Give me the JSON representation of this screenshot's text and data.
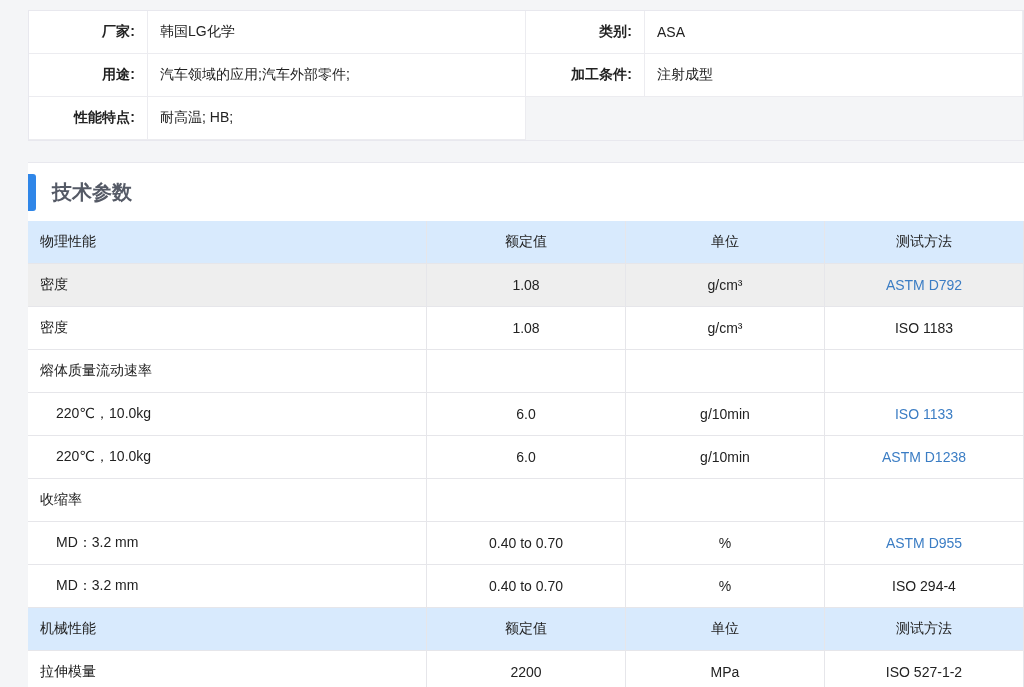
{
  "info": {
    "rows": [
      {
        "cells": [
          {
            "label": "厂家:",
            "value": "韩国LG化学"
          },
          {
            "label": "类别:",
            "value": "ASA"
          }
        ]
      },
      {
        "cells": [
          {
            "label": "用途:",
            "value": "汽车领域的应用;汽车外部零件;"
          },
          {
            "label": "加工条件:",
            "value": "注射成型"
          }
        ]
      },
      {
        "cells": [
          {
            "label": "性能特点:",
            "value": "耐高温; HB;"
          }
        ]
      }
    ]
  },
  "tech": {
    "title": "技术参数",
    "rows": [
      {
        "kind": "header",
        "name": "物理性能",
        "value": "额定值",
        "unit": "单位",
        "method": "测试方法"
      },
      {
        "kind": "data",
        "highlighted": true,
        "name": "密度",
        "value": "1.08",
        "unit": "g/cm³",
        "method": "ASTM D792",
        "link": true
      },
      {
        "kind": "data",
        "highlighted": false,
        "name": "密度",
        "value": "1.08",
        "unit": "g/cm³",
        "method": "ISO 1183",
        "link": false
      },
      {
        "kind": "group",
        "name": "熔体质量流动速率"
      },
      {
        "kind": "sub",
        "highlighted": false,
        "name": "220℃，10.0kg",
        "value": "6.0",
        "unit": "g/10min",
        "method": "ISO 1133",
        "link": true
      },
      {
        "kind": "sub",
        "highlighted": false,
        "name": "220℃，10.0kg",
        "value": "6.0",
        "unit": "g/10min",
        "method": "ASTM D1238",
        "link": true
      },
      {
        "kind": "group",
        "name": "收缩率"
      },
      {
        "kind": "sub",
        "highlighted": false,
        "name": "MD：3.2 mm",
        "value": "0.40 to 0.70",
        "unit": "%",
        "method": "ASTM D955",
        "link": true
      },
      {
        "kind": "sub",
        "highlighted": false,
        "name": "MD：3.2 mm",
        "value": "0.40 to 0.70",
        "unit": "%",
        "method": "ISO 294-4",
        "link": false
      },
      {
        "kind": "header",
        "name": "机械性能",
        "value": "额定值",
        "unit": "单位",
        "method": "测试方法"
      },
      {
        "kind": "data",
        "highlighted": false,
        "name": "拉伸模量",
        "value": "2200",
        "unit": "MPa",
        "method": "ISO 527-1-2",
        "link": false
      }
    ]
  }
}
